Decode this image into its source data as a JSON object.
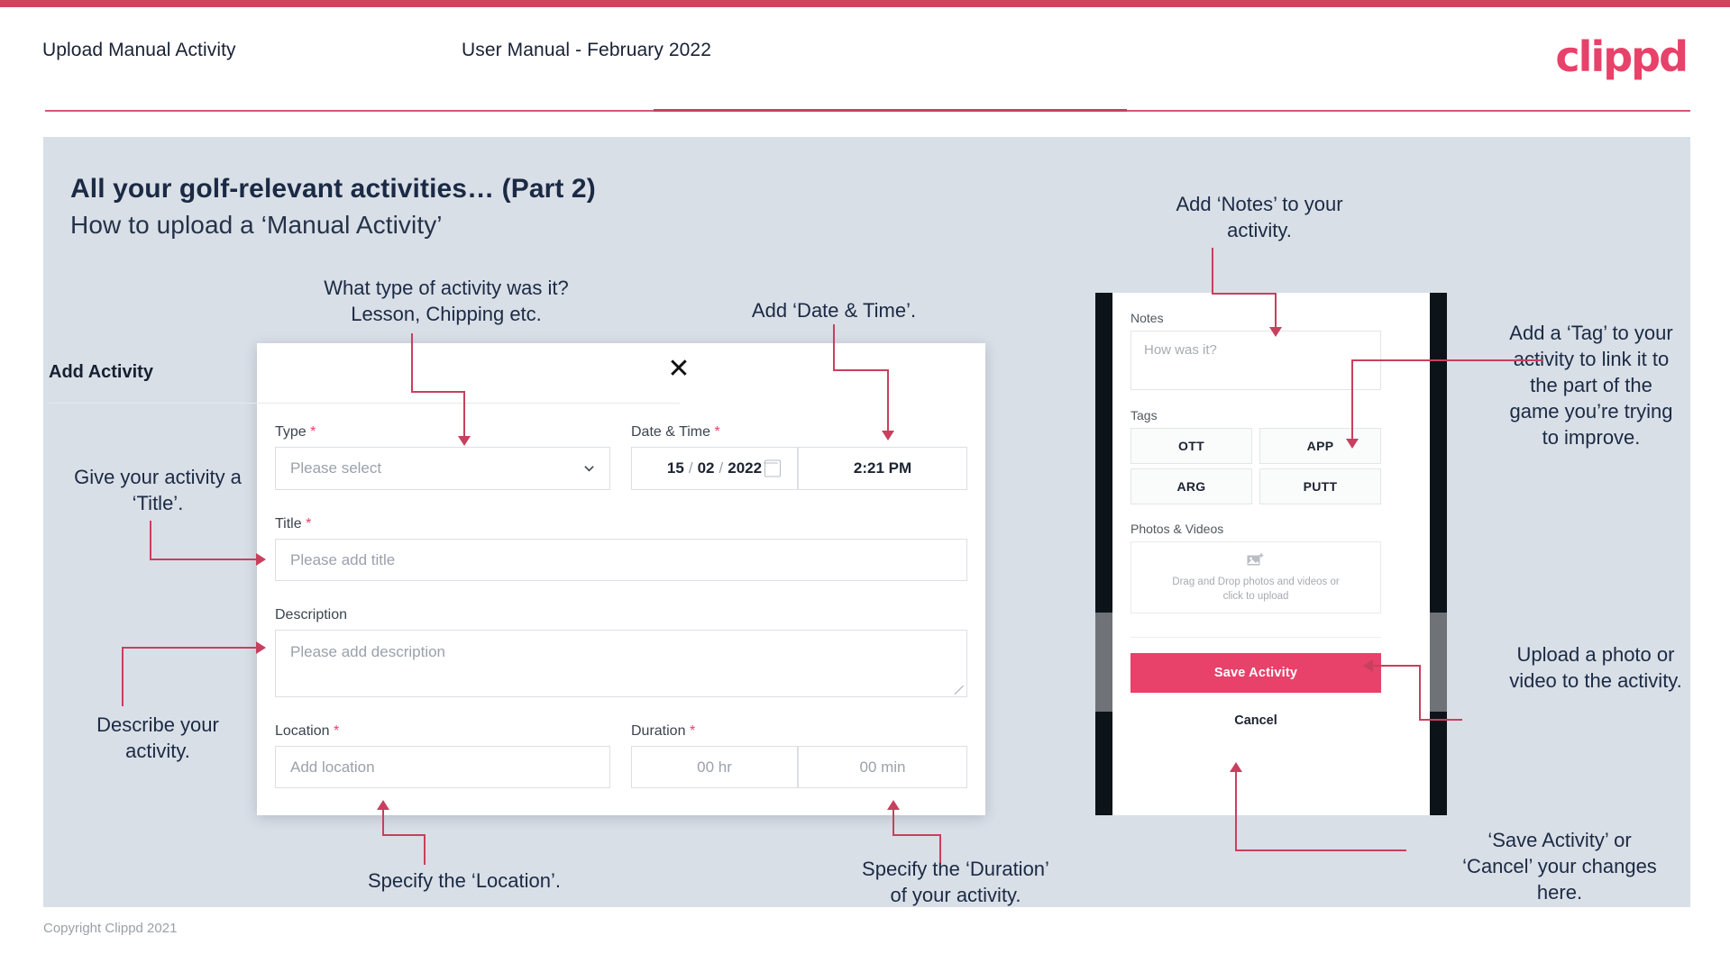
{
  "header": {
    "title": "Upload Manual Activity",
    "subtitle": "User Manual - February 2022",
    "logo": "clippd"
  },
  "slide": {
    "title": "All your golf-relevant activities… (Part 2)",
    "subtitle": "How to upload a ‘Manual Activity’"
  },
  "footer": {
    "copyright": "Copyright Clippd 2021"
  },
  "dialog": {
    "title": "Add Activity",
    "close_icon": "close-icon",
    "fields": {
      "type": {
        "label": "Type",
        "required": "*",
        "placeholder": "Please select",
        "chevron_icon": "chevron-down-icon"
      },
      "datetime": {
        "label": "Date & Time",
        "required": "*",
        "day": "15",
        "sep1": "/",
        "month": "02",
        "sep2": "/",
        "year": "2022",
        "calendar_icon": "calendar-icon",
        "time": "2:21 PM"
      },
      "title": {
        "label": "Title",
        "required": "*",
        "placeholder": "Please add title"
      },
      "description": {
        "label": "Description",
        "placeholder": "Please add description"
      },
      "location": {
        "label": "Location",
        "required": "*",
        "placeholder": "Add location"
      },
      "duration": {
        "label": "Duration",
        "required": "*",
        "hours": "00 hr",
        "minutes": "00 min"
      }
    }
  },
  "phone": {
    "notes": {
      "label": "Notes",
      "placeholder": "How was it?"
    },
    "tags": {
      "label": "Tags",
      "items": [
        "OTT",
        "APP",
        "ARG",
        "PUTT"
      ]
    },
    "photos": {
      "label": "Photos & Videos",
      "icon": "image-add-icon",
      "drop_line1": "Drag and Drop photos and videos or",
      "drop_line2": "click to upload"
    },
    "save_label": "Save Activity",
    "cancel_label": "Cancel"
  },
  "annotations": {
    "type": "What type of activity was it?\nLesson, Chipping etc.",
    "datetime": "Add ‘Date & Time’.",
    "title": "Give your activity a\n‘Title’.",
    "description": "Describe your\nactivity.",
    "location": "Specify the ‘Location’.",
    "duration": "Specify the ‘Duration’\nof your activity.",
    "notes": "Add ‘Notes’ to your\nactivity.",
    "tags": "Add a ‘Tag’ to your\nactivity to link it to\nthe part of the\ngame you’re trying\nto improve.",
    "upload": "Upload a photo or\nvideo to the activity.",
    "save": "‘Save Activity’ or\n‘Cancel’ your changes\nhere."
  },
  "colors": {
    "accent": "#e8416a",
    "line": "#c8405e",
    "slide_bg": "#d9dfe7",
    "text_dark": "#1b2a44"
  }
}
